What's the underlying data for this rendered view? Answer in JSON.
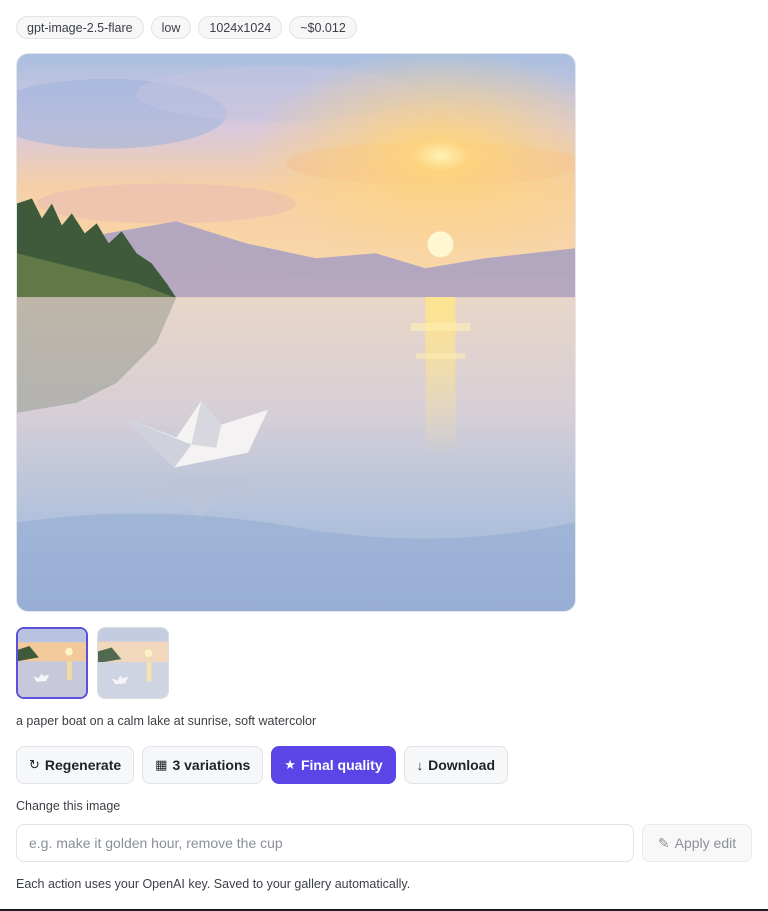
{
  "tags": [
    "gpt-image-2.5-flare",
    "low",
    "1024x1024",
    "~$0.012"
  ],
  "image": {
    "caption": "a paper boat on a calm lake at sunrise, soft watercolor",
    "thumbnail_count": 2,
    "selected_thumbnail": 1
  },
  "actions": {
    "regenerate": {
      "icon": "refresh-icon",
      "glyph": "↻",
      "label": "Regenerate"
    },
    "variations": {
      "icon": "grid-icon",
      "glyph": "▦",
      "label": "3 variations"
    },
    "final_quality": {
      "icon": "star-icon",
      "glyph": "★",
      "label": "Final quality"
    },
    "download": {
      "icon": "arrow-down-icon",
      "glyph": "↓",
      "label": "Download"
    }
  },
  "edit": {
    "label": "Change this image",
    "placeholder": "e.g. make it golden hour, remove the cup",
    "value": "",
    "apply_icon": "pencil-icon",
    "apply_glyph": "✎",
    "apply_label": "Apply edit"
  },
  "note": "Each action uses your OpenAI key. Saved to your gallery automatically.",
  "colors": {
    "accent": "#5b45e6",
    "selected_border": "#5b4fdc",
    "tag_bg": "#f7f7f8",
    "button_bg": "#f6f7f9"
  }
}
